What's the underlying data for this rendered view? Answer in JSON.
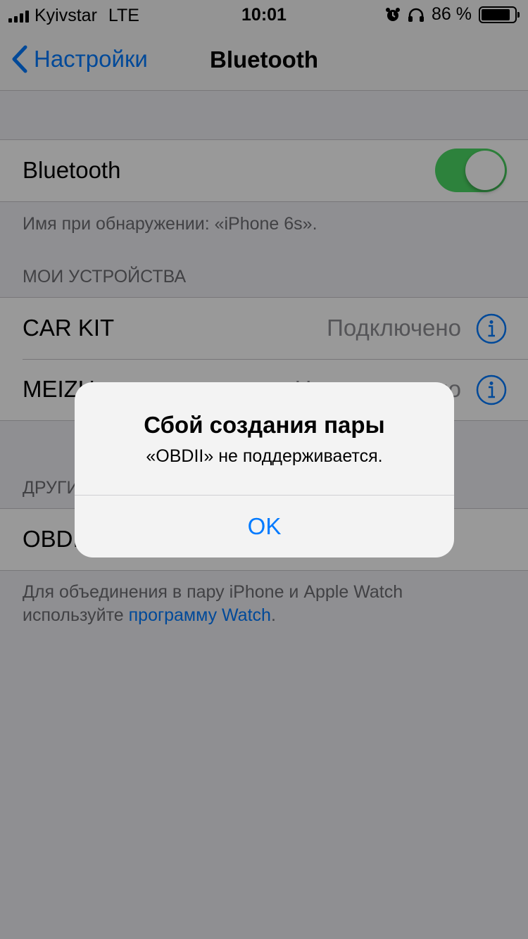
{
  "status": {
    "carrier": "Kyivstar",
    "network": "LTE",
    "time": "10:01",
    "battery_percent": "86 %",
    "battery_level": 0.86,
    "icons": [
      "signal-icon",
      "alarm-icon",
      "headphones-icon",
      "battery-icon"
    ]
  },
  "nav": {
    "back_label": "Настройки",
    "title": "Bluetooth"
  },
  "bluetooth": {
    "label": "Bluetooth",
    "enabled": true,
    "discovery_note": "Имя при обнаружении: «iPhone 6s»."
  },
  "my_devices": {
    "header": "МОИ УСТРОЙСТВА",
    "items": [
      {
        "name": "CAR KIT",
        "status": "Подключено"
      },
      {
        "name": "MEIZU",
        "status": "Не подключено"
      }
    ]
  },
  "other_devices": {
    "header": "ДРУГИЕ УСТРОЙСТВА",
    "items": [
      {
        "name": "OBDII"
      }
    ]
  },
  "footer": {
    "text_before": "Для объединения в пару iPhone и Apple Watch",
    "text_line2_prefix": "используйте ",
    "link": "программу Watch",
    "text_after": "."
  },
  "alert": {
    "title": "Сбой создания пары",
    "message": "«OBDII» не поддерживается.",
    "button": "OK"
  },
  "colors": {
    "accent": "#007aff",
    "toggle_on": "#4cd964"
  }
}
